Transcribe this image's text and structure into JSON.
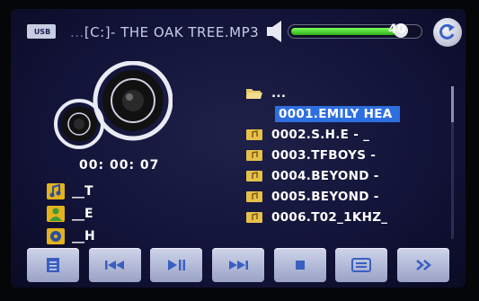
{
  "topbar": {
    "mode_badge": "USB",
    "path_prefix": "...",
    "path_text": "[C:]- THE OAK TREE.MP3",
    "volume": {
      "value": "40",
      "level_fraction": 0.88
    }
  },
  "player": {
    "elapsed_time": "00: 00: 07",
    "meta": [
      {
        "icon": "music-note-icon",
        "text": "__T"
      },
      {
        "icon": "person-icon",
        "text": "__E"
      },
      {
        "icon": "album-icon",
        "text": "__H"
      }
    ]
  },
  "file_list": {
    "parent": "...",
    "items": [
      {
        "label": "0001.EMILY HEA",
        "selected": true
      },
      {
        "label": "0002.S.H.E  -  _",
        "selected": false
      },
      {
        "label": "0003.TFBOYS  -",
        "selected": false
      },
      {
        "label": "0004.BEYOND  -",
        "selected": false
      },
      {
        "label": "0005.BEYOND  -",
        "selected": false
      },
      {
        "label": "0006.T02_1KHZ_",
        "selected": false
      }
    ]
  },
  "controls": [
    "list-icon",
    "prev-icon",
    "play-pause-icon",
    "next-icon",
    "stop-icon",
    "eq-icon",
    "more-icon"
  ],
  "colors": {
    "selection": "#2e6fe0",
    "volume_fill": "#3fd32a",
    "background": "#13143a"
  }
}
